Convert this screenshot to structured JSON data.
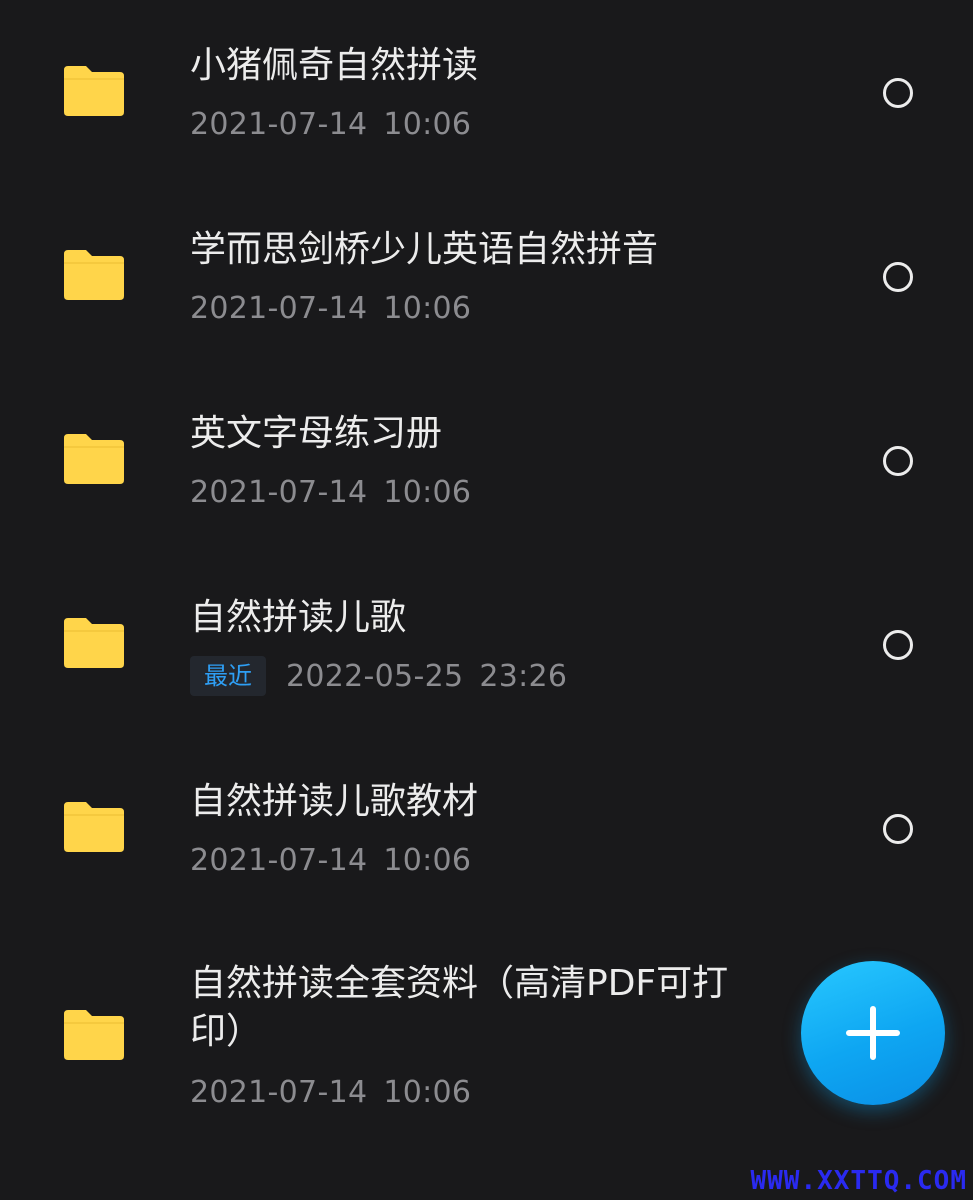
{
  "files": [
    {
      "name": "小猪佩奇自然拼读",
      "date": "2021-07-14",
      "time": "10:06",
      "badge": ""
    },
    {
      "name": "学而思剑桥少儿英语自然拼音",
      "date": "2021-07-14",
      "time": "10:06",
      "badge": ""
    },
    {
      "name": "英文字母练习册",
      "date": "2021-07-14",
      "time": "10:06",
      "badge": ""
    },
    {
      "name": "自然拼读儿歌",
      "date": "2022-05-25",
      "time": "23:26",
      "badge": "最近"
    },
    {
      "name": "自然拼读儿歌教材",
      "date": "2021-07-14",
      "time": "10:06",
      "badge": ""
    },
    {
      "name": "自然拼读全套资料（高清PDF可打印）",
      "date": "2021-07-14",
      "time": "10:06",
      "badge": ""
    }
  ],
  "colors": {
    "background": "#19191b",
    "folder": "#ffd54a",
    "accent": "#0ea6f2",
    "badge_text": "#2e9ff5"
  },
  "icons": {
    "folder": "folder-icon",
    "select": "radio-unchecked-icon",
    "add": "plus-icon"
  },
  "watermark": "WWW.XXTTQ.COM"
}
